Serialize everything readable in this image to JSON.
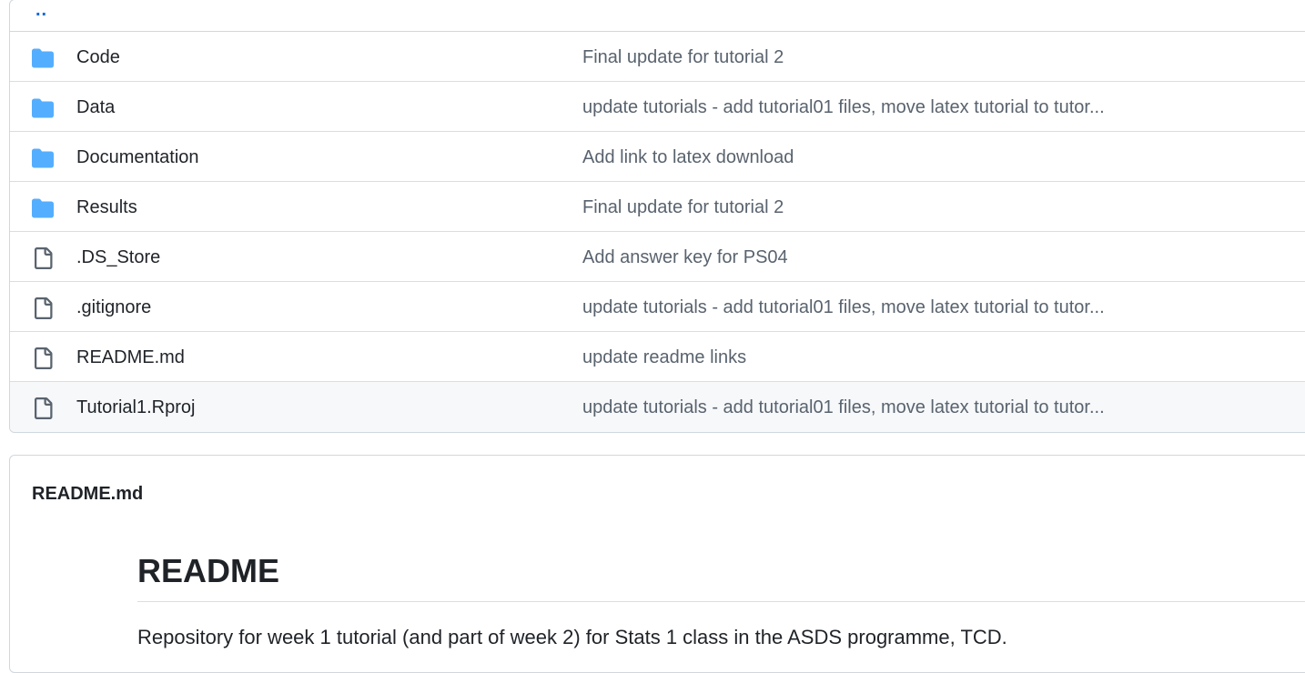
{
  "file_list": {
    "parent_link": "..",
    "rows": [
      {
        "name": "Code",
        "type": "folder",
        "icon": "folder-icon",
        "commit": "Final update for tutorial 2"
      },
      {
        "name": "Data",
        "type": "folder",
        "icon": "folder-icon",
        "commit": "update tutorials - add tutorial01 files, move latex tutorial to tutor..."
      },
      {
        "name": "Documentation",
        "type": "folder",
        "icon": "folder-icon",
        "commit": "Add link to latex download"
      },
      {
        "name": "Results",
        "type": "folder",
        "icon": "folder-icon",
        "commit": "Final update for tutorial 2"
      },
      {
        "name": ".DS_Store",
        "type": "file",
        "icon": "file-icon",
        "commit": "Add answer key for PS04"
      },
      {
        "name": ".gitignore",
        "type": "file",
        "icon": "file-icon",
        "commit": "update tutorials - add tutorial01 files, move latex tutorial to tutor..."
      },
      {
        "name": "README.md",
        "type": "file",
        "icon": "file-icon",
        "commit": "update readme links"
      },
      {
        "name": "Tutorial1.Rproj",
        "type": "file",
        "icon": "file-icon",
        "commit": "update tutorials - add tutorial01 files, move latex tutorial to tutor..."
      }
    ]
  },
  "readme": {
    "header_label": "README.md",
    "heading": "README",
    "paragraph": "Repository for week 1 tutorial (and part of week 2) for Stats 1 class in the ASDS programme, TCD."
  },
  "colors": {
    "folder": "#54aeff",
    "file_icon": "#59636e",
    "link": "#0969da",
    "muted_text": "#59636e",
    "border": "#d0d7de"
  }
}
